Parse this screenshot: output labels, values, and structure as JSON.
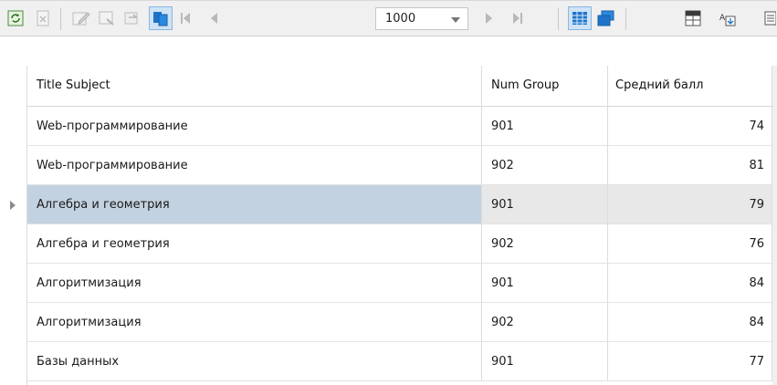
{
  "toolbar": {
    "page_size": "1000",
    "icons": [
      "refresh-icon",
      "cancel-icon",
      "edit-icon",
      "save-icon",
      "revert-icon",
      "copy-icon",
      "first-page-icon",
      "prev-page-icon",
      "next-page-icon",
      "last-page-icon",
      "grid-view-icon",
      "window-icon",
      "table-icon",
      "export-icon",
      "panel-icon"
    ]
  },
  "columns": {
    "title_subject": "Title Subject",
    "num_group": "Num Group",
    "avg_score": "Средний балл"
  },
  "rows": [
    {
      "subject": "Web-программирование",
      "group": "901",
      "score": "74"
    },
    {
      "subject": "Web-программирование",
      "group": "902",
      "score": "81"
    },
    {
      "subject": "Алгебра и геометрия",
      "group": "901",
      "score": "79"
    },
    {
      "subject": "Алгебра и геометрия",
      "group": "902",
      "score": "76"
    },
    {
      "subject": "Алгоритмизация",
      "group": "901",
      "score": "84"
    },
    {
      "subject": "Алгоритмизация",
      "group": "902",
      "score": "84"
    },
    {
      "subject": "Базы данных",
      "group": "901",
      "score": "77"
    }
  ],
  "selected_row": 2,
  "colors": {
    "selection": "#c3d2e0",
    "accent": "#1f74c9"
  }
}
